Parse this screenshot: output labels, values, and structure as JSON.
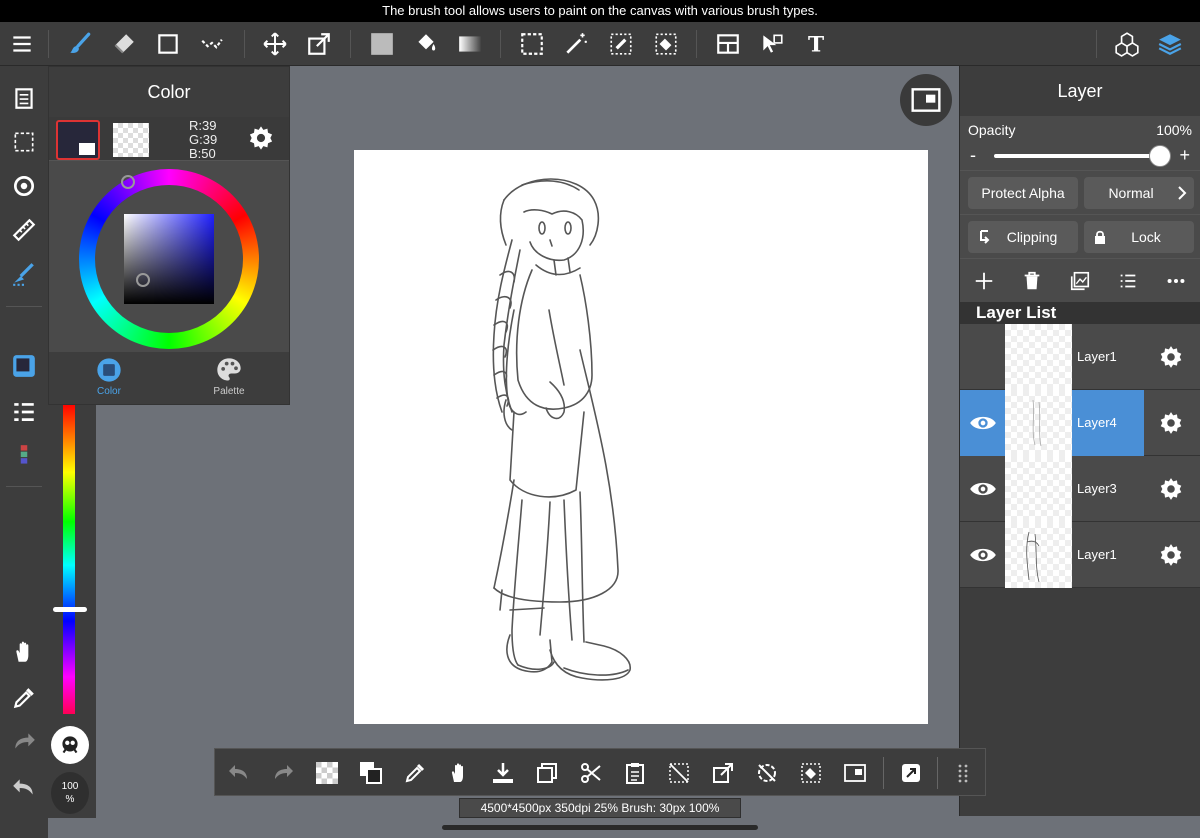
{
  "tooltip": "The brush tool allows users to paint on the canvas with various brush types.",
  "color_panel": {
    "title": "Color",
    "rgb_r": "R:39",
    "rgb_g": "G:39",
    "rgb_b": "B:50",
    "main_color": "#27273a",
    "tabs": [
      {
        "label": "Color",
        "active": true
      },
      {
        "label": "Palette",
        "active": false
      }
    ]
  },
  "zoom": {
    "value": "100",
    "unit": "%"
  },
  "layer_panel": {
    "title": "Layer",
    "opacity_label": "Opacity",
    "opacity_value": "100%",
    "minus": "-",
    "plus": "+",
    "protect_alpha": "Protect Alpha",
    "blend_mode": "Normal",
    "clipping": "Clipping",
    "lock": "Lock",
    "list_header": "Layer List",
    "layers": [
      {
        "name": "Layer1",
        "visible": false,
        "selected": false
      },
      {
        "name": "Layer4",
        "visible": true,
        "selected": true
      },
      {
        "name": "Layer3",
        "visible": true,
        "selected": false
      },
      {
        "name": "Layer1",
        "visible": true,
        "selected": false
      }
    ]
  },
  "status": "4500*4500px 350dpi 25% Brush: 30px 100%",
  "colors": {
    "accent": "#4a8fd6",
    "panel": "#3d3d3d",
    "workspace": "#6d7178"
  }
}
